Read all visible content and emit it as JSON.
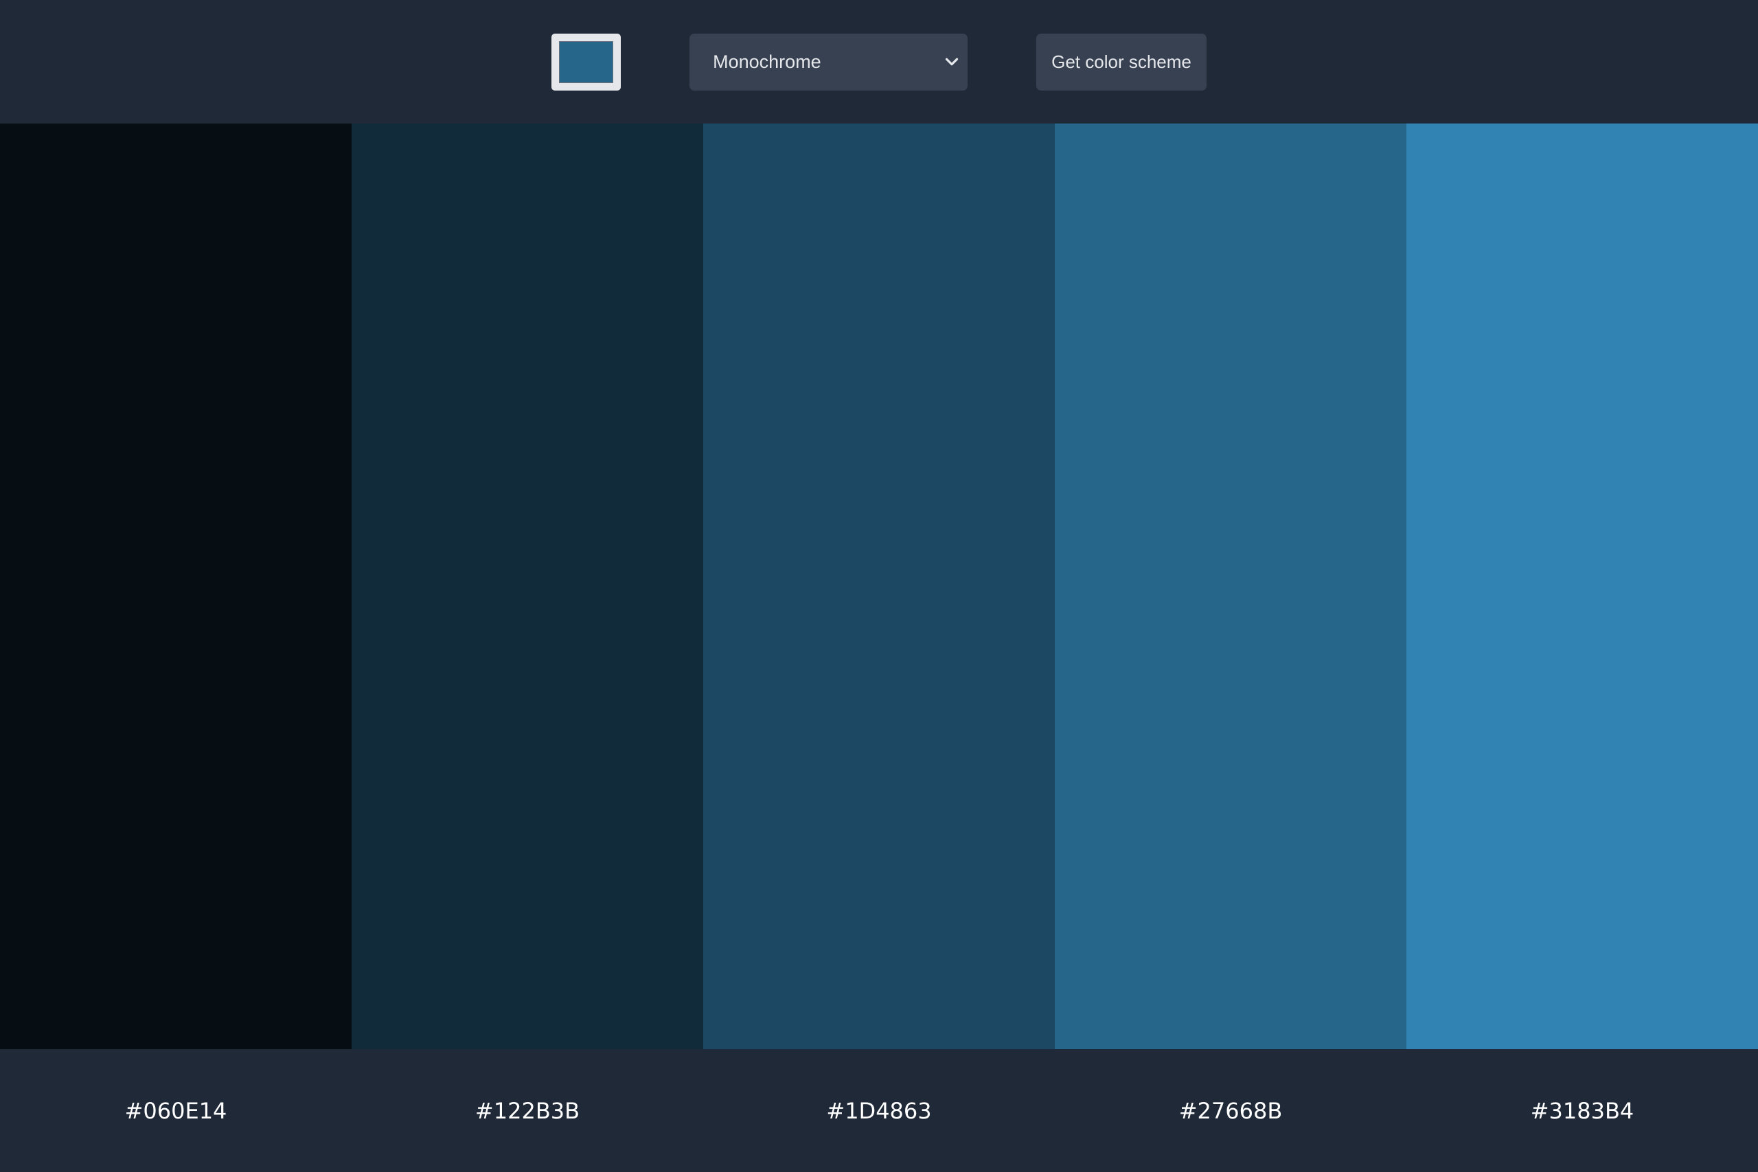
{
  "toolbar": {
    "seed_color": "#27668B",
    "mode": {
      "selected": "Monochrome",
      "icon": "chevron-down-icon"
    },
    "get_scheme_label": "Get color scheme"
  },
  "colors": {
    "toolbar_background": "#1F2937",
    "control_background": "#374151",
    "text": "#E5E7EB"
  },
  "palette": [
    {
      "hex": "#060E14"
    },
    {
      "hex": "#122B3B"
    },
    {
      "hex": "#1D4863"
    },
    {
      "hex": "#27668B"
    },
    {
      "hex": "#3183B4"
    }
  ]
}
